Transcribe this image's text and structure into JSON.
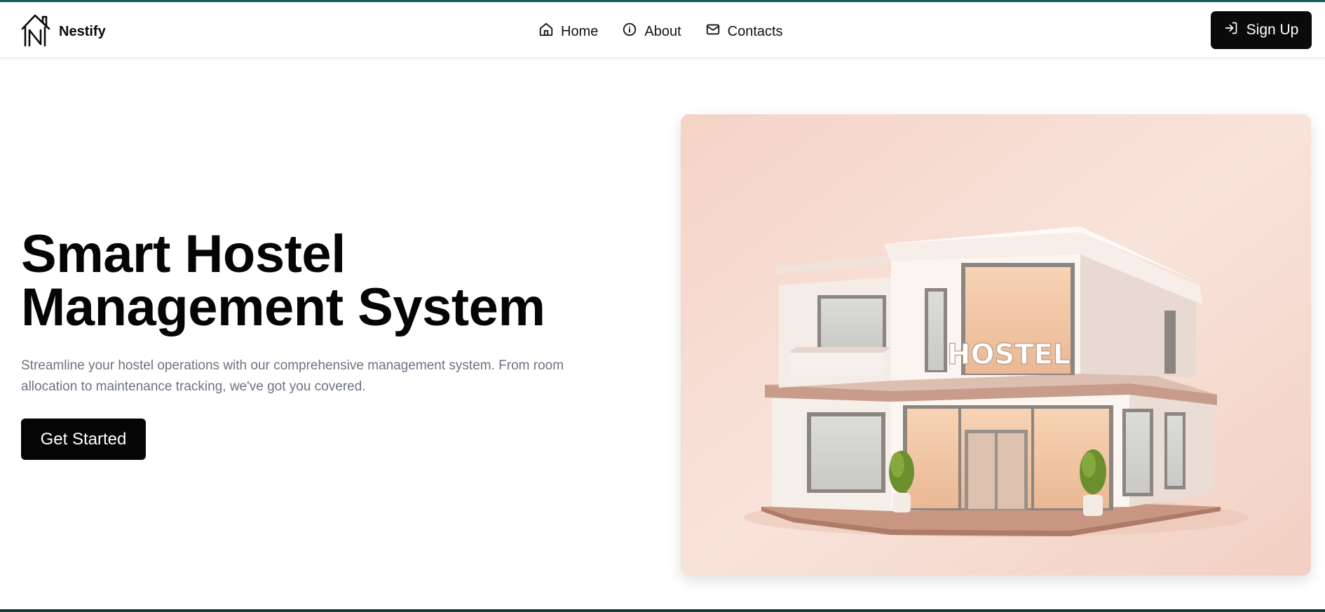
{
  "brand": {
    "name": "Nestify",
    "logo_icon": "house-n-logo-icon"
  },
  "nav": {
    "items": [
      {
        "label": "Home",
        "icon": "home-icon"
      },
      {
        "label": "About",
        "icon": "info-icon"
      },
      {
        "label": "Contacts",
        "icon": "mail-icon"
      }
    ]
  },
  "auth": {
    "signup_label": "Sign Up",
    "signup_icon": "log-in-icon"
  },
  "hero": {
    "title_line1": "Smart Hostel",
    "title_line2": "Management System",
    "description": "Streamline your hostel operations with our comprehensive management system. From room allocation to maintenance tracking, we've got you covered.",
    "cta_label": "Get Started",
    "image_sign": "HOSTEL"
  },
  "colors": {
    "accent_top": "#0f5f5c",
    "button_bg": "#050505",
    "muted_text": "#6b7280",
    "hero_bg": "#f6d8cd"
  }
}
